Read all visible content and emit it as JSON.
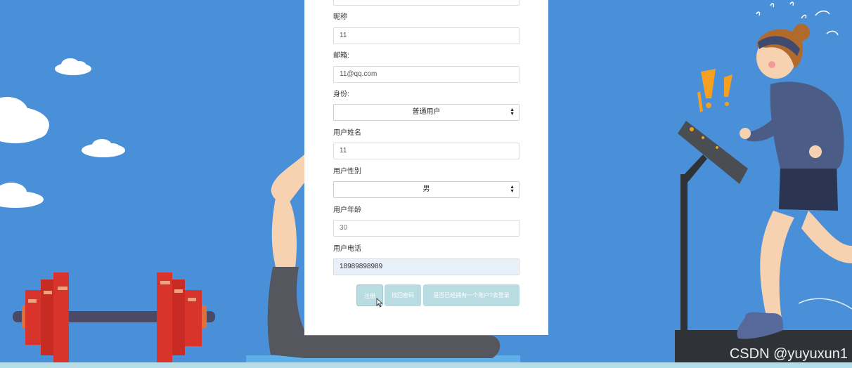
{
  "form": {
    "nickname": {
      "label": "昵称",
      "value": "11"
    },
    "email": {
      "label": "邮箱:",
      "value": "11@qq.com"
    },
    "role": {
      "label": "身份:",
      "value": "普通用户"
    },
    "name": {
      "label": "用户姓名",
      "value": "11"
    },
    "gender": {
      "label": "用户性别",
      "value": "男"
    },
    "age": {
      "label": "用户年龄",
      "value": "30"
    },
    "phone": {
      "label": "用户电话",
      "value": "18989898989"
    }
  },
  "buttons": {
    "register": "注册",
    "recover": "找回密码",
    "login": "是否已经拥有一个账户?去登录"
  },
  "watermark": "CSDN @yuyuxun1",
  "colors": {
    "background": "#4a90d9",
    "button": "#b9dbe2",
    "dumbbell": "#d9342b",
    "runner_jacket": "#4b5d86"
  }
}
